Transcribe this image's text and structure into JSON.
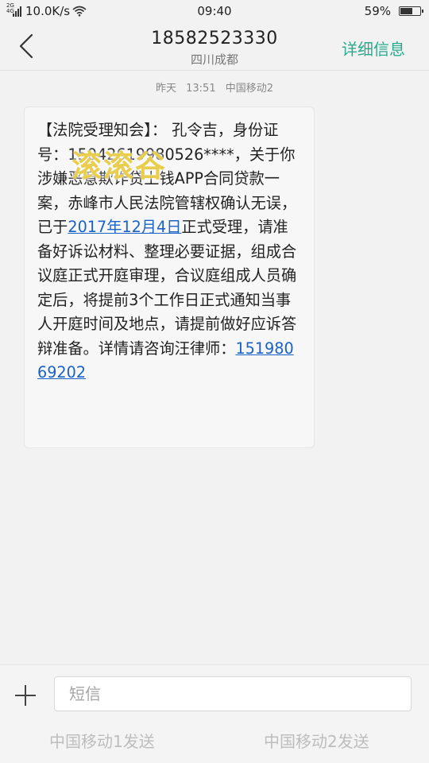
{
  "status_bar": {
    "network_label": "2G 4G",
    "speed": "10.0K/s",
    "time": "09:40",
    "battery_percent_text": "59%",
    "battery_level": 0.59
  },
  "header": {
    "phone_number": "18582523330",
    "location": "四川成都",
    "details_label": "详细信息",
    "accent_color": "#2aab8e"
  },
  "timestamp": {
    "day": "昨天",
    "time": "13:51",
    "carrier": "中国移动2"
  },
  "message": {
    "text_part1": "【法院受理知会】： 孔令吉，身份证号：15042619980526****，关于你涉嫌恶意欺诈贷上钱APP合同贷款一案，赤峰市人民法院管辖权确认无误，已于",
    "date_link": "2017年12月4日",
    "text_part2": "正式受理，请准备好诉讼材料、整理必要证据，组成合议庭正式开庭审理，合议庭组成人员确定后，将提前3个工作日正式通知当事人开庭时间及地点，请提前做好应诉答辩准备。详情请咨询汪律师：",
    "phone_link": "15198069202",
    "link_color": "#1a62c6"
  },
  "watermark": {
    "text": "滚滚谷"
  },
  "composer": {
    "placeholder": "短信",
    "send_sim1_label": "中国移动1发送",
    "send_sim2_label": "中国移动2发送"
  }
}
